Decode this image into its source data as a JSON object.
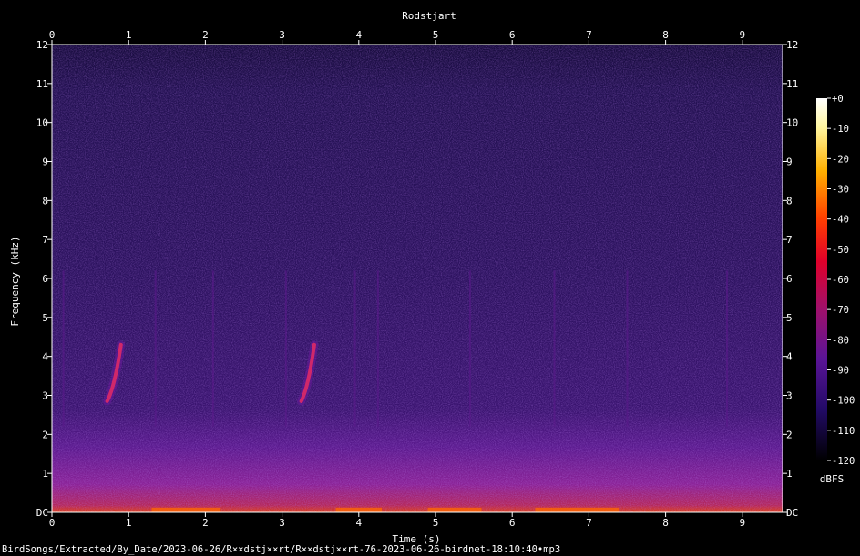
{
  "chart_data": {
    "type": "heatmap",
    "title": "Rodstjart",
    "xlabel": "Time (s)",
    "ylabel": "Frequency (kHz)",
    "xlim": [
      0,
      9.5
    ],
    "ylim": [
      0,
      12
    ],
    "x_ticks": [
      "0",
      "1",
      "2",
      "3",
      "4",
      "5",
      "6",
      "7",
      "8",
      "9"
    ],
    "y_ticks": [
      "DC",
      "1",
      "2",
      "3",
      "4",
      "5",
      "6",
      "7",
      "8",
      "9",
      "10",
      "11",
      "12"
    ],
    "colorbar": {
      "label": "dBFS",
      "range": [
        -120,
        0
      ],
      "ticks": [
        "+0",
        "-10",
        "-20",
        "-30",
        "-40",
        "-50",
        "-60",
        "-70",
        "-80",
        "-90",
        "-100",
        "-110",
        "-120"
      ]
    },
    "features": [
      {
        "time_start": 0.72,
        "time_end": 0.9,
        "freq_start_khz": 2.85,
        "freq_end_khz": 4.3
      },
      {
        "time_start": 3.25,
        "time_end": 3.42,
        "freq_start_khz": 2.85,
        "freq_end_khz": 4.3
      }
    ],
    "colors": {
      "background": "#000000",
      "noise": "#2a1060",
      "low_band": "#6a1a9a",
      "signal": "#d0286a",
      "peak": "#ff6a00"
    }
  },
  "footer": {
    "filename": "BirdSongs/Extracted/By_Date/2023-06-26/R××dstj××rt/R××dstj××rt-76-2023-06-26-birdnet-18:10:40•mp3"
  }
}
